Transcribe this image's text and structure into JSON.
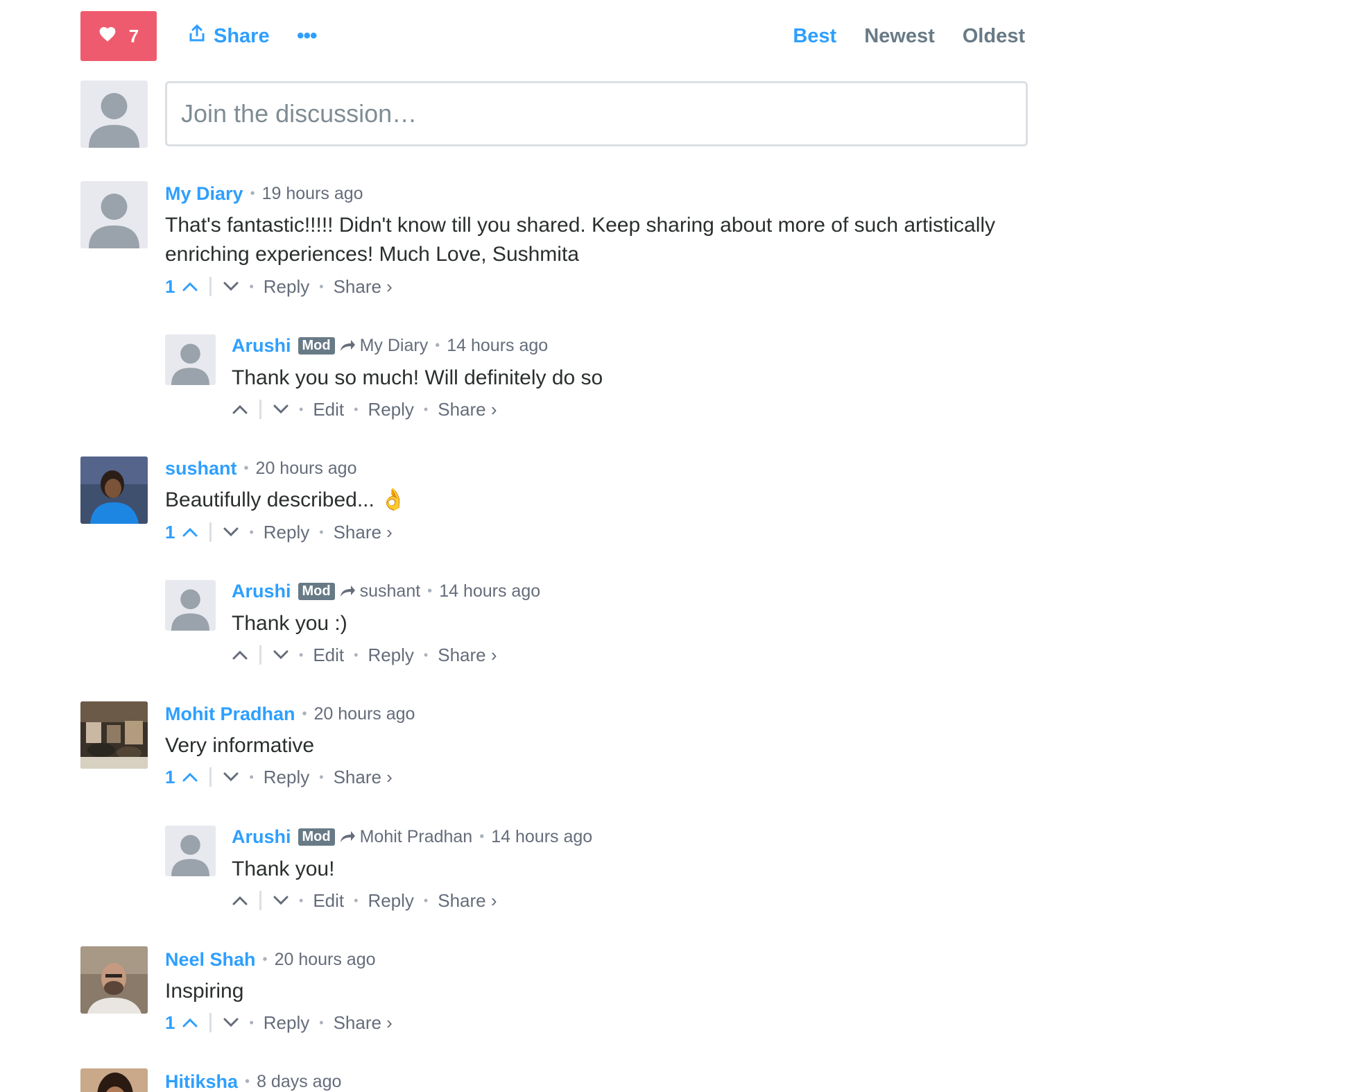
{
  "toolbar": {
    "favorite_count": "7",
    "share_label": "Share",
    "more_label": "•••",
    "sort_tabs": [
      {
        "label": "Best",
        "active": true
      },
      {
        "label": "Newest",
        "active": false
      },
      {
        "label": "Oldest",
        "active": false
      }
    ]
  },
  "composer": {
    "placeholder": "Join the discussion…"
  },
  "comments": [
    {
      "author": "My Diary",
      "time": "19 hours ago",
      "text_line1": "That's fantastic!!!!! Didn't know till you shared. Keep sharing about more of such artistically",
      "text_line2": "enriching experiences! Much Love, Sushmita",
      "votes": "1",
      "reply_label": "Reply",
      "share_label": "Share ›"
    },
    {
      "author": "Arushi",
      "badge": "Mod",
      "parent": "My Diary",
      "time": "14 hours ago",
      "text": "Thank you so much! Will definitely do so",
      "edit_label": "Edit",
      "reply_label": "Reply",
      "share_label": "Share ›"
    },
    {
      "author": "sushant",
      "time": "20 hours ago",
      "text": "Beautifully described... 👌",
      "votes": "1",
      "reply_label": "Reply",
      "share_label": "Share ›"
    },
    {
      "author": "Arushi",
      "badge": "Mod",
      "parent": "sushant",
      "time": "14 hours ago",
      "text": "Thank you :)",
      "edit_label": "Edit",
      "reply_label": "Reply",
      "share_label": "Share ›"
    },
    {
      "author": "Mohit Pradhan",
      "time": "20 hours ago",
      "text": "Very informative",
      "votes": "1",
      "reply_label": "Reply",
      "share_label": "Share ›"
    },
    {
      "author": "Arushi",
      "badge": "Mod",
      "parent": "Mohit Pradhan",
      "time": "14 hours ago",
      "text": "Thank you!",
      "edit_label": "Edit",
      "reply_label": "Reply",
      "share_label": "Share ›"
    },
    {
      "author": "Neel Shah",
      "time": "20 hours ago",
      "text": "Inspiring",
      "votes": "1",
      "reply_label": "Reply",
      "share_label": "Share ›"
    },
    {
      "author": "Hitiksha",
      "time": "8 days ago"
    }
  ],
  "colors": {
    "accent": "#2e9fff",
    "favorite": "#ef5b6e",
    "muted": "#656c7a",
    "border": "#dbdfe4"
  }
}
